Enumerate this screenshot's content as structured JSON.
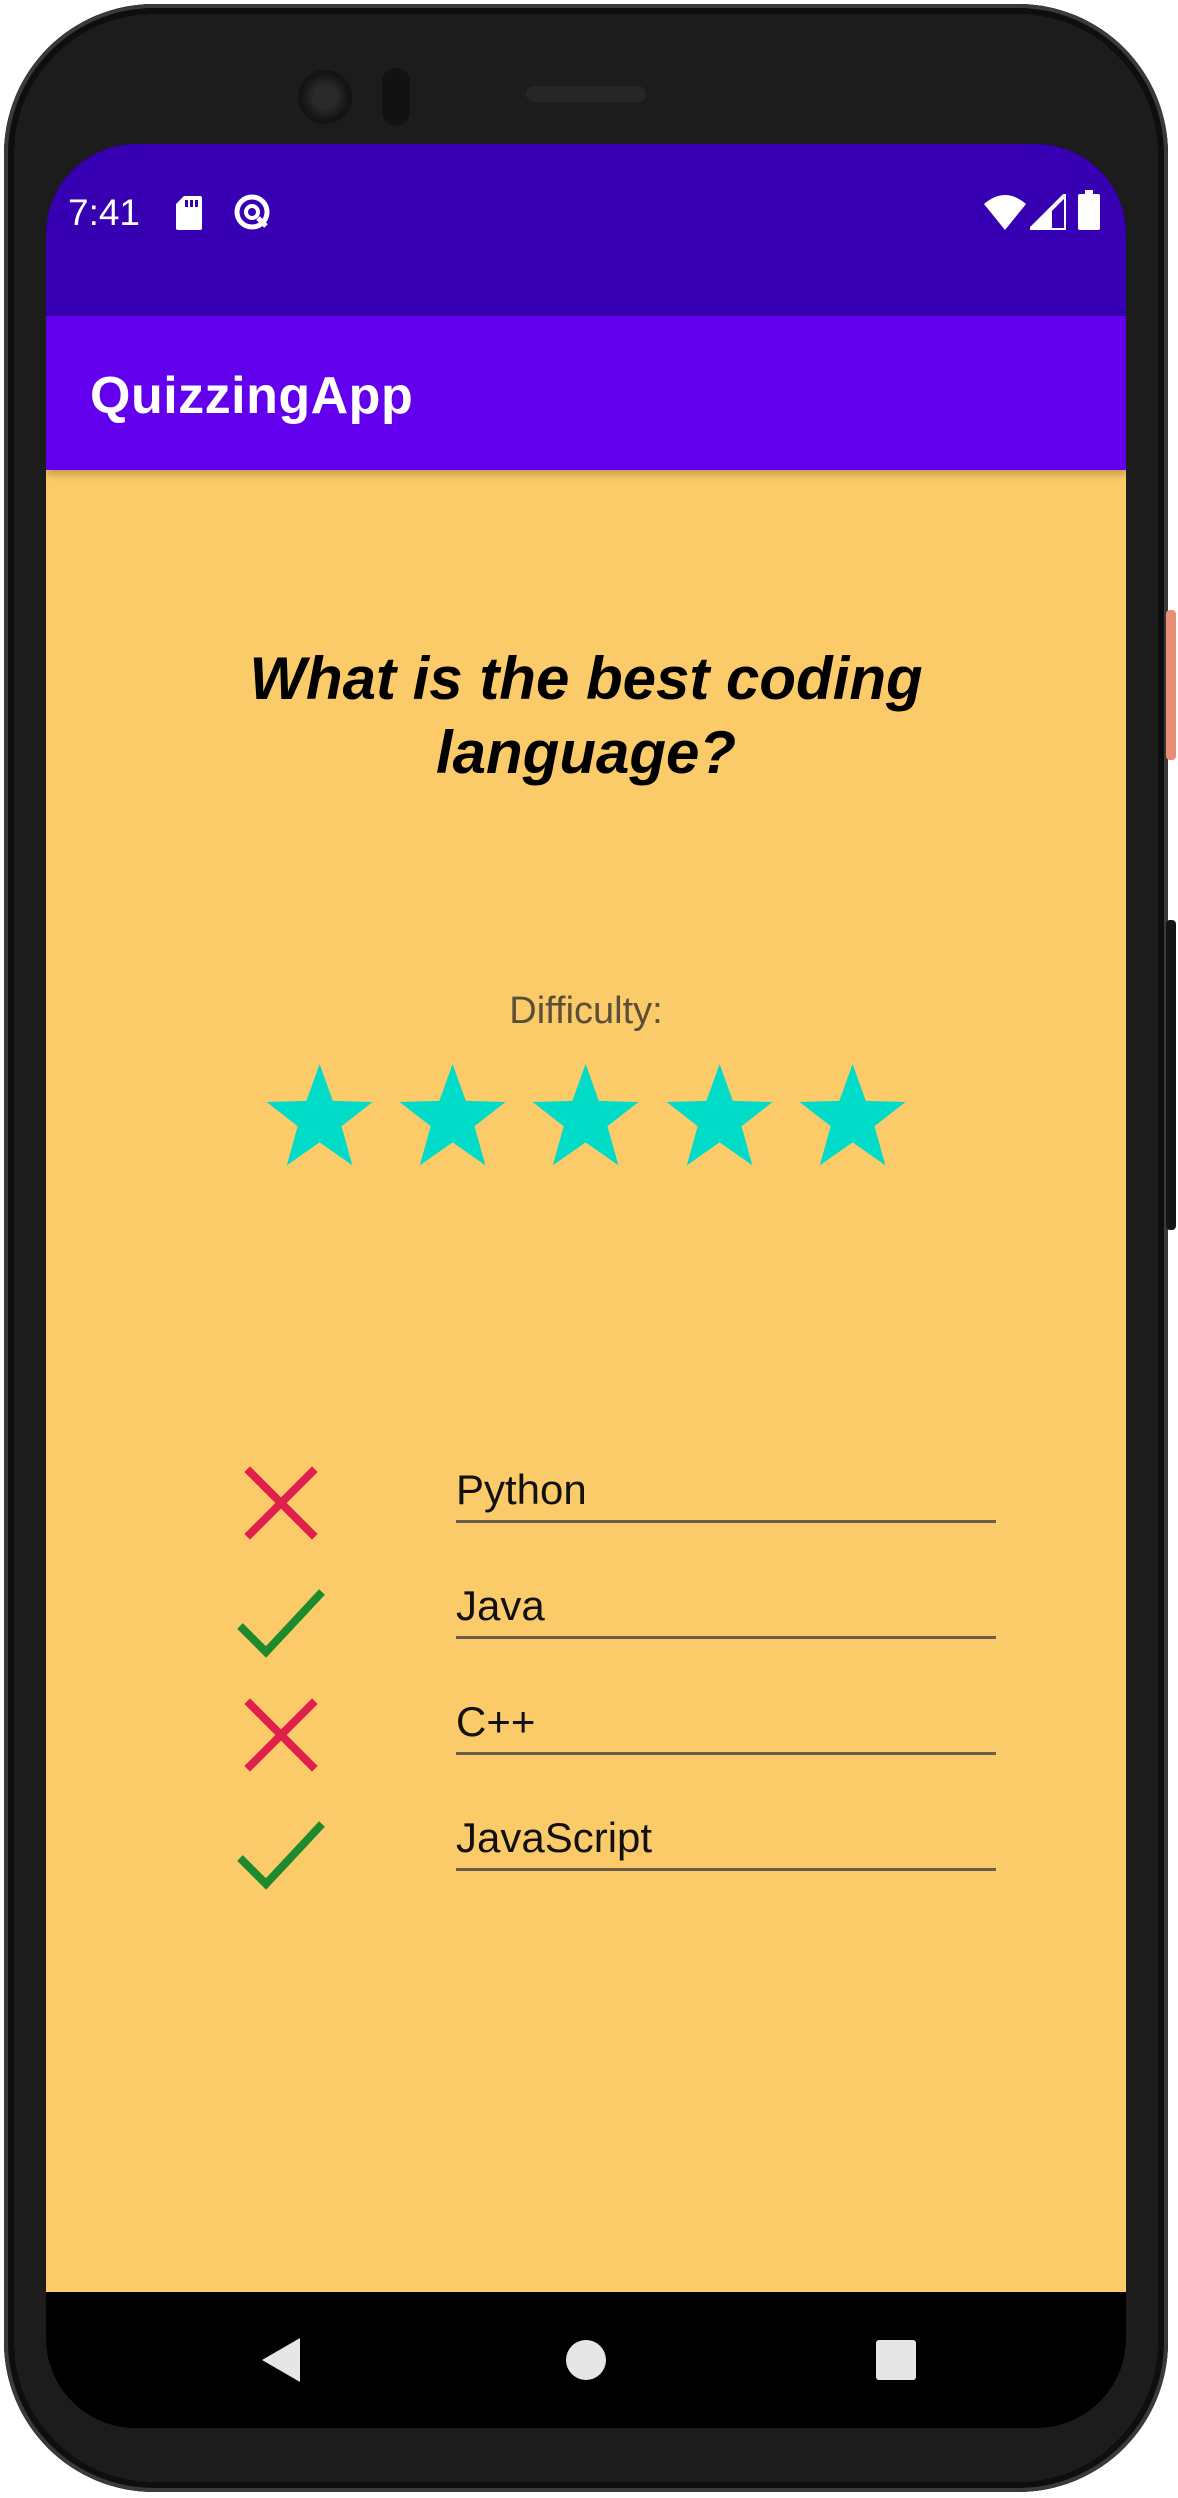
{
  "status_bar": {
    "time": "7:41",
    "left_icons": [
      "sd-card-icon",
      "data-saver-icon"
    ],
    "right_icons": [
      "wifi-icon",
      "signal-icon",
      "battery-icon"
    ]
  },
  "app_bar": {
    "title": "QuizzingApp"
  },
  "quiz": {
    "question": "What is the best coding language?",
    "difficulty_label": "Difficulty:",
    "difficulty_rating": 5,
    "difficulty_max": 5,
    "answers": [
      {
        "text": "Python",
        "correct": false,
        "mark_icon": "cross-icon"
      },
      {
        "text": "Java",
        "correct": true,
        "mark_icon": "check-icon"
      },
      {
        "text": "C++",
        "correct": false,
        "mark_icon": "cross-icon"
      },
      {
        "text": "JavaScript",
        "correct": true,
        "mark_icon": "check-icon"
      }
    ]
  },
  "nav_bar": {
    "buttons": [
      "back-icon",
      "home-icon",
      "recents-icon"
    ]
  },
  "colors": {
    "status_bar": "#3700b3",
    "app_bar": "#6200ee",
    "background": "#fccb69",
    "star": "#00dcc8",
    "cross": "#e0204a",
    "check": "#1e8a2e"
  }
}
